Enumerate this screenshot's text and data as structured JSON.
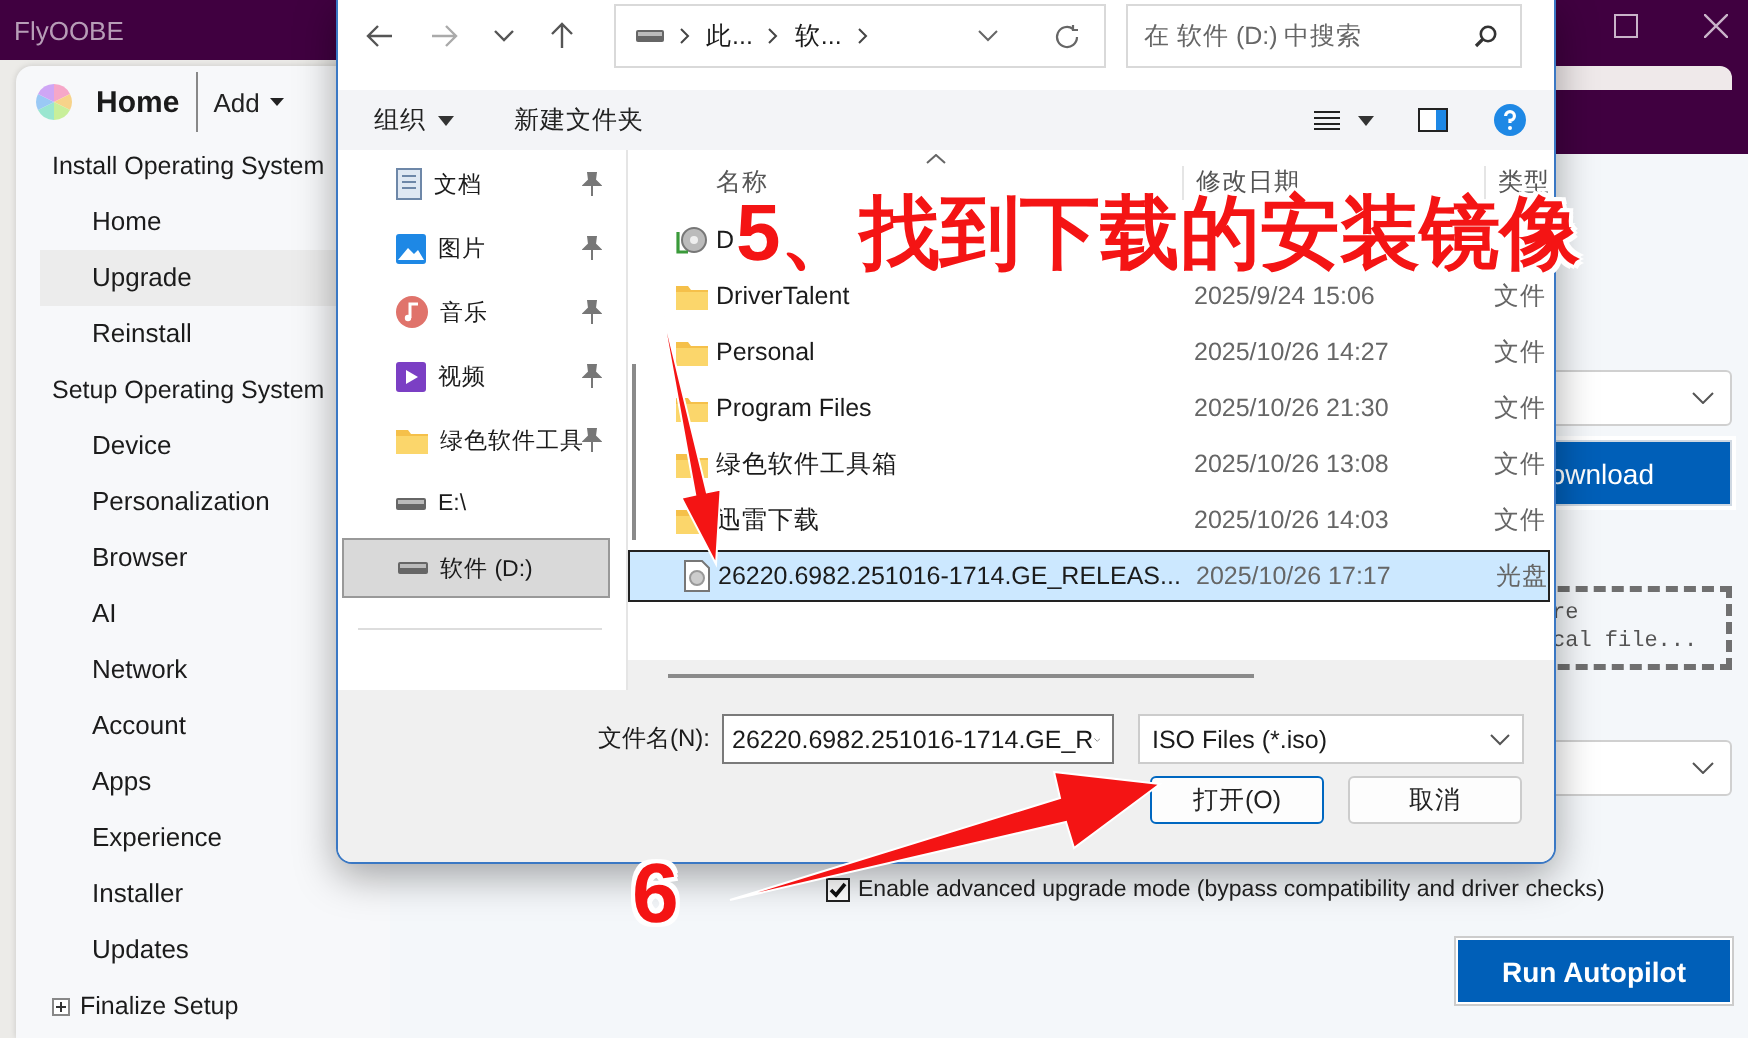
{
  "app": {
    "title": "FlyOOBE"
  },
  "sidebar": {
    "title": "Home",
    "add_label": "Add",
    "groups": [
      {
        "label": "Install Operating System",
        "expander": false,
        "items": [
          {
            "label": "Home",
            "selected": false
          },
          {
            "label": "Upgrade",
            "selected": true
          },
          {
            "label": "Reinstall",
            "selected": false
          }
        ]
      },
      {
        "label": "Setup Operating System",
        "expander": false,
        "items": [
          {
            "label": "Device",
            "selected": false
          },
          {
            "label": "Personalization",
            "selected": false
          },
          {
            "label": "Browser",
            "selected": false
          },
          {
            "label": "AI",
            "selected": false
          },
          {
            "label": "Network",
            "selected": false
          },
          {
            "label": "Account",
            "selected": false
          },
          {
            "label": "Apps",
            "selected": false
          },
          {
            "label": "Experience",
            "selected": false
          },
          {
            "label": "Installer",
            "selected": false
          },
          {
            "label": "Updates",
            "selected": false
          }
        ]
      },
      {
        "label": "Finalize Setup",
        "expander": true
      }
    ]
  },
  "main": {
    "download_button": "ownload",
    "drop_zone": [
      "re",
      "cal file..."
    ],
    "upgrade_option": {
      "label": "Enable advanced upgrade mode (bypass compatibility and driver checks)",
      "checked": true
    },
    "run_button": "Run Autopilot"
  },
  "dialog": {
    "address": [
      "此...",
      "软..."
    ],
    "search_placeholder": "在 软件 (D:) 中搜索",
    "organize": "组织",
    "new_folder": "新建文件夹",
    "nav_pane": [
      {
        "label": "文档",
        "kind": "documents",
        "pinned": true,
        "selected": false
      },
      {
        "label": "图片",
        "kind": "pictures",
        "pinned": true,
        "selected": false
      },
      {
        "label": "音乐",
        "kind": "music",
        "pinned": true,
        "selected": false
      },
      {
        "label": "视频",
        "kind": "videos",
        "pinned": true,
        "selected": false
      },
      {
        "label": "绿色软件工具",
        "kind": "folder",
        "pinned": true,
        "selected": false
      },
      {
        "label": "E:\\",
        "kind": "drive",
        "pinned": false,
        "selected": false
      },
      {
        "label": "软件 (D:)",
        "kind": "drive",
        "pinned": false,
        "selected": true
      }
    ],
    "columns": [
      "名称",
      "修改日期",
      "类型"
    ],
    "files": [
      {
        "name": "D",
        "kind": "computer",
        "selected": false
      },
      {
        "name": "DriverTalent",
        "kind": "folder",
        "modified": "2025/9/24 15:06",
        "type": "文件",
        "selected": false
      },
      {
        "name": "Personal",
        "kind": "folder",
        "modified": "2025/10/26 14:27",
        "type": "文件",
        "selected": false
      },
      {
        "name": "Program Files",
        "kind": "folder",
        "modified": "2025/10/26 21:30",
        "type": "文件",
        "selected": false
      },
      {
        "name": "绿色软件工具箱",
        "kind": "folder",
        "modified": "2025/10/26 13:08",
        "type": "文件",
        "selected": false
      },
      {
        "name": "迅雷下载",
        "kind": "folder",
        "modified": "2025/10/26 14:03",
        "type": "文件",
        "selected": false
      },
      {
        "name": "26220.6982.251016-1714.GE_RELEAS...",
        "kind": "disc",
        "modified": "2025/10/26 17:17",
        "type": "光盘",
        "selected": true
      }
    ],
    "filename_label": "文件名(N):",
    "filename": "26220.6982.251016-1714.GE_R",
    "filter": "ISO Files (*.iso)",
    "buttons": [
      {
        "label": "打开(O)",
        "default": true
      },
      {
        "label": "取消",
        "default": false
      }
    ]
  },
  "annotations": [
    {
      "text": "5、找到下载的安装镜像"
    },
    {
      "text": "6"
    }
  ]
}
